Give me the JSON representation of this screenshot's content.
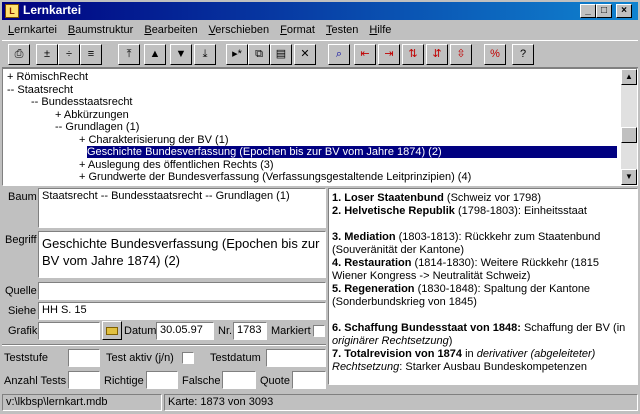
{
  "window": {
    "title": "Lernkartei"
  },
  "menu": [
    "Lernkartei",
    "Baumstruktur",
    "Bearbeiten",
    "Verschieben",
    "Format",
    "Testen",
    "Hilfe"
  ],
  "toolbar": {
    "icons": [
      "printer-icon",
      "plus-minus-icon",
      "collapse-icon",
      "list-icon",
      "move-top-icon",
      "move-up-icon",
      "move-down-icon",
      "move-bottom-icon",
      "goto-icon",
      "copy-icon",
      "paste-icon",
      "delete-icon",
      "find-icon",
      "indent-left-icon",
      "indent-right-icon",
      "sort-up-icon",
      "sort-down-icon",
      "sort-alt-icon",
      "percent-icon",
      "help-icon"
    ],
    "glyphs": [
      "⎙",
      "±",
      "÷",
      "≡",
      "⤒",
      "▲",
      "▼",
      "⤓",
      "▸*",
      "⧉",
      "▤",
      "✕",
      "⌕",
      "⇤",
      "⇥",
      "⇅",
      "⇵",
      "⇳",
      "%",
      "?"
    ]
  },
  "tree": {
    "items": [
      "+ RömischRecht",
      "-- Staatsrecht",
      "-- Bundesstaatsrecht",
      "+ Abkürzungen",
      "-- Grundlagen (1)",
      "+ Charakterisierung der BV (1)",
      "Geschichte Bundesverfassung (Epochen bis zur BV vom Jahre 1874) (2)",
      "+ Auslegung des öffentlichen Rechts (3)",
      "+ Grundwerte der Bundesverfassung (Verfassungsgestaltende Leitprinzipien) (4)"
    ],
    "selected_index": 6
  },
  "form": {
    "baum_label": "Baum",
    "baum_value": "Staatsrecht -- Bundesstaatsrecht -- Grundlagen (1)",
    "begriff_label": "Begriff",
    "begriff_value": "Geschichte Bundesverfassung (Epochen bis zur BV vom Jahre 1874) (2)",
    "quelle_label": "Quelle",
    "quelle_value": "",
    "siehe_label": "Siehe",
    "siehe_value": "HH S. 15",
    "grafik_label": "Grafik",
    "grafik_value": "",
    "datum_label": "Datum",
    "datum_value": "30.05.97",
    "nr_label": "Nr.",
    "nr_value": "1783",
    "markiert_label": "Markiert",
    "teststufe_label": "Teststufe",
    "teststufe_value": "",
    "testaktiv_label": "Test aktiv (j/n)",
    "testdatum_label": "Testdatum",
    "testdatum_value": "",
    "anzahl_label": "Anzahl Tests",
    "anzahl_value": "",
    "richtige_label": "Richtige",
    "richtige_value": "",
    "falsche_label": "Falsche",
    "falsche_value": "",
    "quote_label": "Quote",
    "quote_value": ""
  },
  "answer": {
    "paragraphs": [
      [
        {
          "b": "1. Loser Staatenbund"
        },
        {
          "t": " (Schweiz vor 1798)"
        }
      ],
      [
        {
          "b": "2. Helvetische Republik"
        },
        {
          "t": " (1798-1803): Einheitsstaat"
        }
      ],
      [],
      [
        {
          "b": "3. Mediation"
        },
        {
          "t": " (1803-1813): Rückkehr zum Staatenbund (Souveränität der Kantone)"
        }
      ],
      [
        {
          "b": "4. Restauration"
        },
        {
          "t": " (1814-1830): Weitere Rückkehr (1815 Wiener Kongress -> Neutralität Schweiz)"
        }
      ],
      [
        {
          "b": "5. Regeneration"
        },
        {
          "t": " (1830-1848): Spaltung der Kantone (Sonderbundskrieg von 1845)"
        }
      ],
      [],
      [
        {
          "b": "6. Schaffung Bundesstaat von 1848:"
        },
        {
          "t": " Schaffung der BV (in "
        },
        {
          "i": "originärer Rechtsetzung"
        },
        {
          "t": ")"
        }
      ],
      [
        {
          "b": "7. Totalrevision von 1874"
        },
        {
          "t": " in "
        },
        {
          "i": "derivativer (abgeleiteter) Rechtsetzung"
        },
        {
          "t": ": Starker Ausbau Bundeskompetenzen"
        }
      ]
    ]
  },
  "status": {
    "path": "v:\\lkbsp\\lernkart.mdb",
    "card": "Karte: 1873 von 3093"
  },
  "colors": {
    "titlebar": "#000080",
    "selection": "#000080",
    "face": "#c0c0c0"
  }
}
